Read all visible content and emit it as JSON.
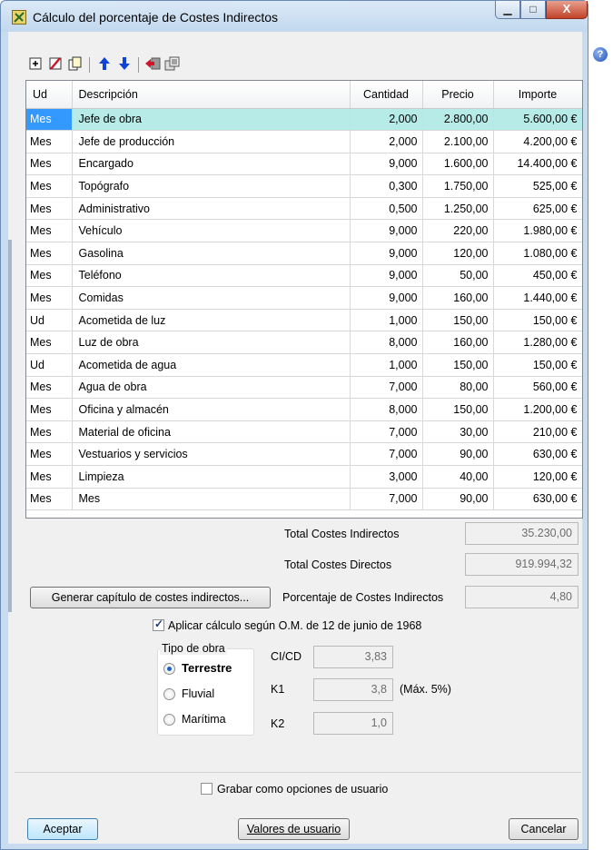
{
  "window": {
    "title": "Cálculo del porcentaje de Costes Indirectos",
    "minimize": "▁",
    "maximize": "□",
    "close": "X"
  },
  "colors": {
    "selection": "#b6ebe8",
    "accent": "#3399ff",
    "arrow_blue": "#1144d6"
  },
  "help": "?",
  "toolbar": [
    {
      "name": "insert-row-icon",
      "glyph": "⊞"
    },
    {
      "name": "delete-row-icon",
      "glyph": "✗"
    },
    {
      "name": "copy-icon",
      "glyph": "❐"
    },
    {
      "name": "move-up-icon",
      "glyph": "⬆"
    },
    {
      "name": "move-down-icon",
      "glyph": "⬇"
    },
    {
      "name": "import-icon",
      "glyph": "⇥"
    },
    {
      "name": "copy-pages-icon",
      "glyph": "⎘"
    }
  ],
  "table": {
    "headers": [
      "Ud",
      "Descripción",
      "Cantidad",
      "Precio",
      "Importe"
    ],
    "rows": [
      [
        "Mes",
        "Jefe de obra",
        "2,000",
        "2.800,00",
        "5.600,00 €"
      ],
      [
        "Mes",
        "Jefe de producción",
        "2,000",
        "2.100,00",
        "4.200,00 €"
      ],
      [
        "Mes",
        "Encargado",
        "9,000",
        "1.600,00",
        "14.400,00 €"
      ],
      [
        "Mes",
        "Topógrafo",
        "0,300",
        "1.750,00",
        "525,00 €"
      ],
      [
        "Mes",
        "Administrativo",
        "0,500",
        "1.250,00",
        "625,00 €"
      ],
      [
        "Mes",
        "Vehículo",
        "9,000",
        "220,00",
        "1.980,00 €"
      ],
      [
        "Mes",
        "Gasolina",
        "9,000",
        "120,00",
        "1.080,00 €"
      ],
      [
        "Mes",
        "Teléfono",
        "9,000",
        "50,00",
        "450,00 €"
      ],
      [
        "Mes",
        "Comidas",
        "9,000",
        "160,00",
        "1.440,00 €"
      ],
      [
        "Ud",
        "Acometida de luz",
        "1,000",
        "150,00",
        "150,00 €"
      ],
      [
        "Mes",
        "Luz de obra",
        "8,000",
        "160,00",
        "1.280,00 €"
      ],
      [
        "Ud",
        "Acometida de agua",
        "1,000",
        "150,00",
        "150,00 €"
      ],
      [
        "Mes",
        "Agua de obra",
        "7,000",
        "80,00",
        "560,00 €"
      ],
      [
        "Mes",
        "Oficina y almacén",
        "8,000",
        "150,00",
        "1.200,00 €"
      ],
      [
        "Mes",
        "Material de oficina",
        "7,000",
        "30,00",
        "210,00 €"
      ],
      [
        "Mes",
        "Vestuarios y servicios",
        "7,000",
        "90,00",
        "630,00 €"
      ],
      [
        "Mes",
        "Limpieza",
        "3,000",
        "40,00",
        "120,00 €"
      ],
      [
        "Mes",
        "Mes",
        "7,000",
        "90,00",
        "630,00 €"
      ]
    ]
  },
  "summary": {
    "total_ci_label": "Total Costes Indirectos",
    "total_ci_value": "35.230,00",
    "total_cd_label": "Total Costes Directos",
    "total_cd_value": "919.994,32",
    "generate_button": "Generar capítulo de costes indirectos...",
    "pct_label": "Porcentaje de Costes Indirectos",
    "pct_value": "4,80"
  },
  "om": {
    "checkbox_label": "Aplicar cálculo según O.M. de 12 de junio de 1968",
    "checked": true,
    "group_title": "Tipo de obra",
    "options": [
      "Terrestre",
      "Fluvial",
      "Marítima"
    ],
    "selected": "Terrestre",
    "cicd_label": "CI/CD",
    "cicd_value": "3,83",
    "k1_label": "K1",
    "k1_value": "3,8",
    "k1_note": "(Máx. 5%)",
    "k2_label": "K2",
    "k2_value": "1,0"
  },
  "footer": {
    "save_label": "Grabar como opciones de usuario",
    "accept": "Aceptar",
    "user_values": "Valores de usuario",
    "cancel": "Cancelar"
  }
}
